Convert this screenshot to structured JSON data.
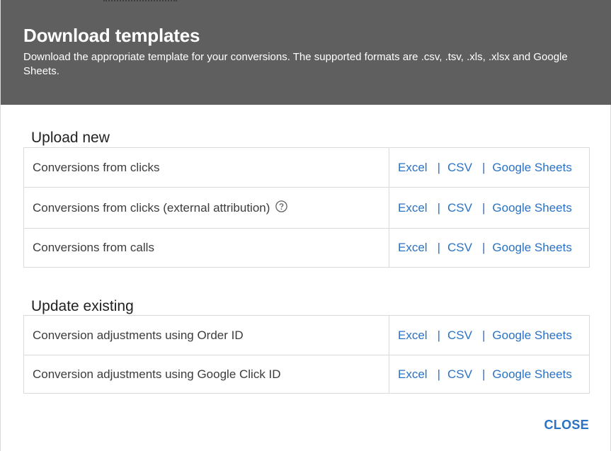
{
  "dialog": {
    "title": "Download templates",
    "subtitle": "Download the appropriate template for your conversions. The supported formats are .csv, .tsv, .xls, .xlsx and Google Sheets."
  },
  "upload_new": {
    "heading": "Upload new",
    "rows": [
      {
        "label": "Conversions from clicks",
        "excel": "Excel",
        "csv": "CSV",
        "sheets": "Google Sheets"
      },
      {
        "label": "Conversions from clicks (external attribution)",
        "excel": "Excel",
        "csv": "CSV",
        "sheets": "Google Sheets",
        "help_icon": "help-circle-icon"
      },
      {
        "label": "Conversions from calls",
        "excel": "Excel",
        "csv": "CSV",
        "sheets": "Google Sheets"
      }
    ]
  },
  "update_existing": {
    "heading": "Update existing",
    "rows": [
      {
        "label": "Conversion adjustments using Order ID",
        "excel": "Excel",
        "csv": "CSV",
        "sheets": "Google Sheets"
      },
      {
        "label": "Conversion adjustments using Google Click ID",
        "excel": "Excel",
        "csv": "CSV",
        "sheets": "Google Sheets"
      }
    ]
  },
  "separator": "|",
  "footer": {
    "close_label": "CLOSE"
  },
  "colors": {
    "header_bg": "#5f5f5f",
    "link": "#2a72c5",
    "border": "#dadada"
  }
}
